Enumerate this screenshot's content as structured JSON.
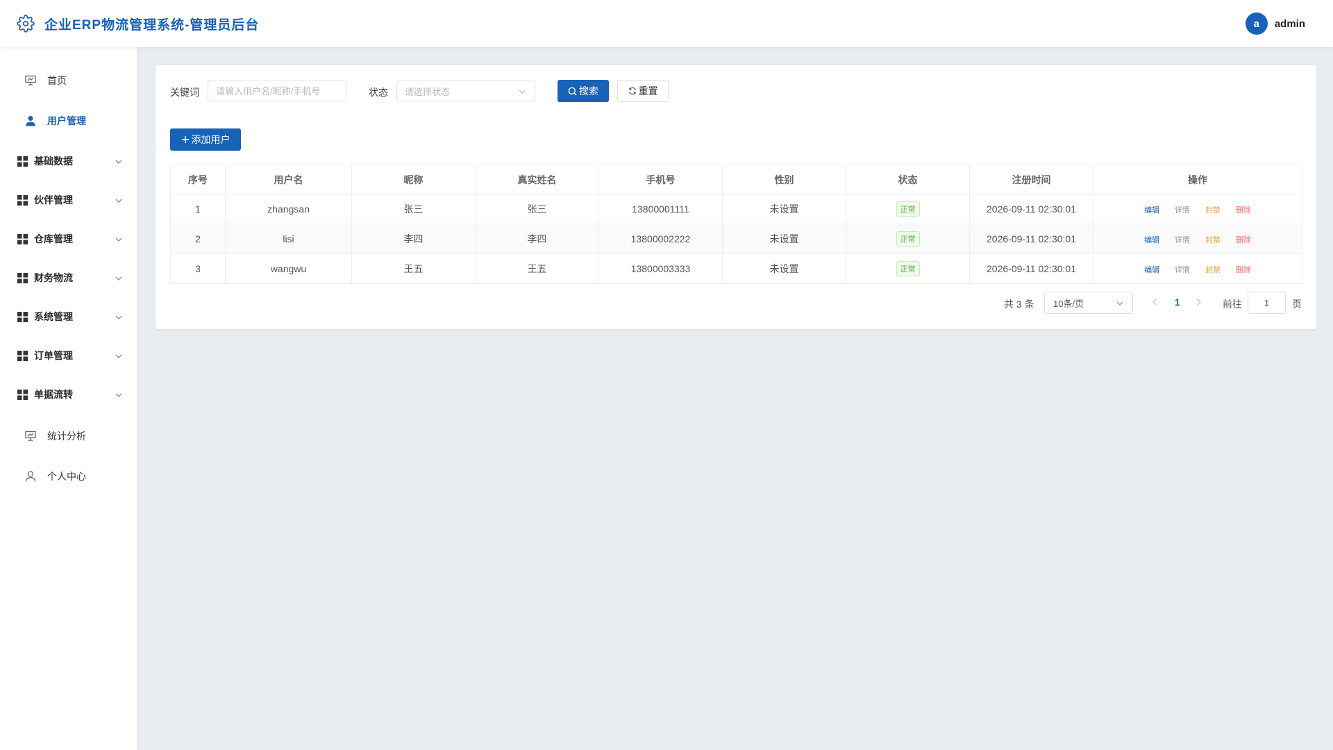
{
  "header": {
    "title": "企业ERP物流管理系统-管理员后台",
    "avatar_letter": "a",
    "username": "admin"
  },
  "sidebar": {
    "items": [
      {
        "label": "首页",
        "icon": "presentation-icon"
      },
      {
        "label": "用户管理",
        "icon": "user-icon",
        "active": true
      },
      {
        "label": "基础数据",
        "icon": "grid-icon",
        "expandable": true
      },
      {
        "label": "伙伴管理",
        "icon": "grid-icon",
        "expandable": true
      },
      {
        "label": "仓库管理",
        "icon": "grid-icon",
        "expandable": true
      },
      {
        "label": "财务物流",
        "icon": "grid-icon",
        "expandable": true
      },
      {
        "label": "系统管理",
        "icon": "grid-icon",
        "expandable": true
      },
      {
        "label": "订单管理",
        "icon": "grid-icon",
        "expandable": true
      },
      {
        "label": "单据流转",
        "icon": "grid-icon",
        "expandable": true
      },
      {
        "label": "统计分析",
        "icon": "presentation-icon"
      },
      {
        "label": "个人中心",
        "icon": "user-outline-icon"
      }
    ]
  },
  "filters": {
    "keyword_label": "关键词",
    "keyword_placeholder": "请输入用户名/昵称/手机号",
    "keyword_value": "",
    "status_label": "状态",
    "status_placeholder": "请选择状态",
    "search_label": "搜索",
    "reset_label": "重置"
  },
  "toolbar": {
    "add_label": "添加用户"
  },
  "table": {
    "columns": [
      "序号",
      "用户名",
      "昵称",
      "真实姓名",
      "手机号",
      "性别",
      "状态",
      "注册时间",
      "操作"
    ],
    "rows": [
      {
        "index": "1",
        "username": "zhangsan",
        "nickname": "张三",
        "realname": "张三",
        "phone": "13800001111",
        "gender": "未设置",
        "status": "正常",
        "registered": "2026-09-11 02:30:01"
      },
      {
        "index": "2",
        "username": "lisi",
        "nickname": "李四",
        "realname": "李四",
        "phone": "13800002222",
        "gender": "未设置",
        "status": "正常",
        "registered": "2026-09-11 02:30:01"
      },
      {
        "index": "3",
        "username": "wangwu",
        "nickname": "王五",
        "realname": "王五",
        "phone": "13800003333",
        "gender": "未设置",
        "status": "正常",
        "registered": "2026-09-11 02:30:01"
      }
    ],
    "actions": {
      "edit": "编辑",
      "detail": "详情",
      "ban": "封禁",
      "delete": "删除"
    }
  },
  "pagination": {
    "total": "共 3 条",
    "page_size": "10条/页",
    "current_page": "1",
    "goto_label": "前往",
    "goto_value": "1",
    "page_unit": "页"
  },
  "colors": {
    "primary": "#1862b8",
    "success": "#52b044",
    "warning": "#e6a23c",
    "danger": "#f56c6c"
  }
}
